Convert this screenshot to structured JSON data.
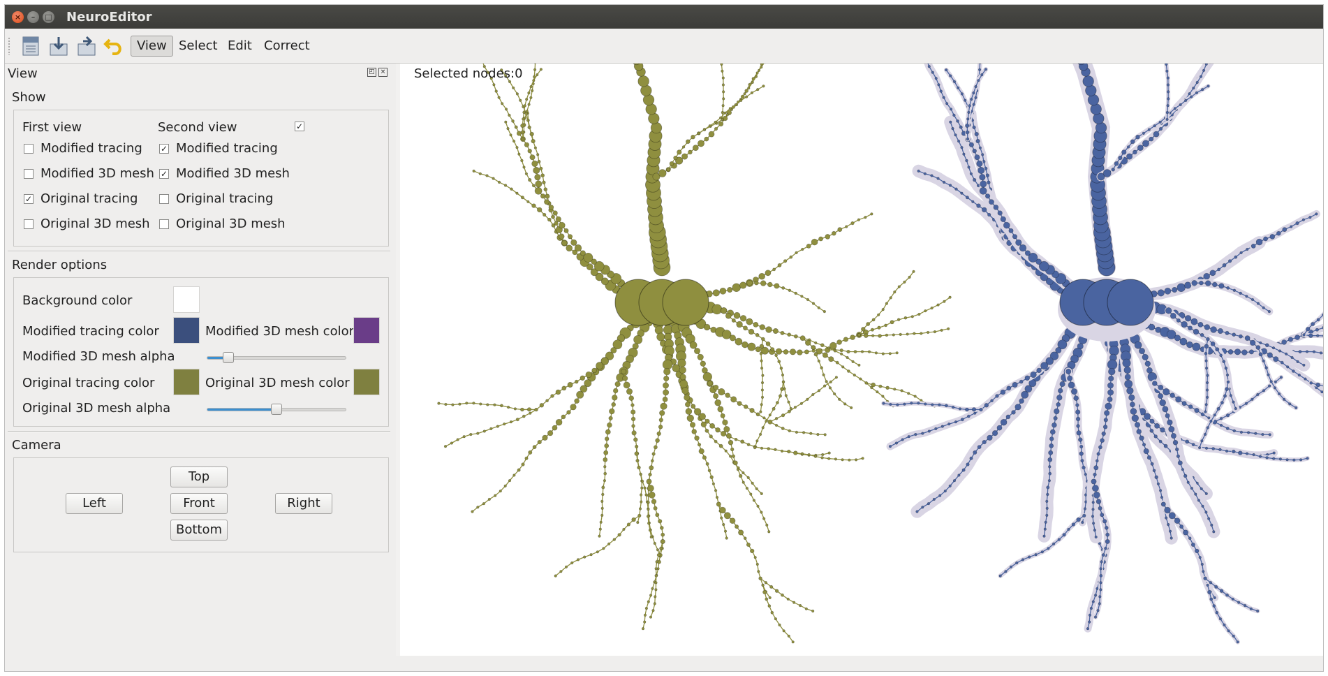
{
  "window": {
    "title": "NeuroEditor"
  },
  "toolbar": {
    "icons": [
      "open-file-icon",
      "save-file-icon",
      "export-file-icon",
      "undo-icon"
    ],
    "menus": [
      "View",
      "Select",
      "Edit",
      "Correct"
    ],
    "active_menu": "View"
  },
  "dock": {
    "title": "View",
    "show": {
      "label": "Show",
      "first_view": {
        "header": "First view",
        "items": [
          {
            "label": "Modified tracing",
            "checked": false
          },
          {
            "label": "Modified 3D mesh",
            "checked": false
          },
          {
            "label": "Original tracing",
            "checked": true
          },
          {
            "label": "Original 3D mesh",
            "checked": false
          }
        ]
      },
      "second_view": {
        "header": "Second view",
        "enabled": true,
        "items": [
          {
            "label": "Modified tracing",
            "checked": true
          },
          {
            "label": "Modified 3D mesh",
            "checked": true
          },
          {
            "label": "Original tracing",
            "checked": false
          },
          {
            "label": "Original 3D mesh",
            "checked": false
          }
        ]
      }
    },
    "render": {
      "label": "Render options",
      "background_color_label": "Background color",
      "background_color": "#ffffff",
      "modified_tracing_color_label": "Modified tracing color",
      "modified_tracing_color": "#3b4f7d",
      "modified_mesh_color_label": "Modified 3D mesh color",
      "modified_mesh_color": "#6a3d88",
      "modified_mesh_alpha_label": "Modified 3D mesh alpha",
      "modified_mesh_alpha": 0.15,
      "original_tracing_color_label": "Original tracing color",
      "original_tracing_color": "#7f8040",
      "original_mesh_color_label": "Original 3D mesh color",
      "original_mesh_color": "#7f8040",
      "original_mesh_alpha_label": "Original 3D mesh alpha",
      "original_mesh_alpha": 0.5
    },
    "camera": {
      "label": "Camera",
      "top": "Top",
      "left": "Left",
      "front": "Front",
      "right": "Right",
      "bottom": "Bottom"
    }
  },
  "viewport": {
    "selected_nodes": "Selected nodes:0",
    "first_view_color": "#8f8f3f",
    "second_view_color": "#4a64a0",
    "mesh_color": "#d9d5e4"
  }
}
